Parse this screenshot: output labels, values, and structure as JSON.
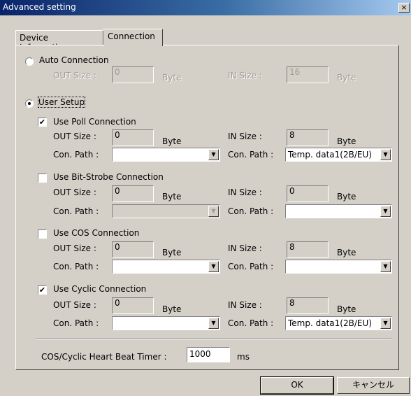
{
  "window": {
    "title": "Advanced setting",
    "close_glyph": "×"
  },
  "tabs": [
    {
      "label": "Device Information",
      "active": false
    },
    {
      "label": "Connection",
      "active": true
    }
  ],
  "auto_connection": {
    "label": "Auto Connection",
    "selected": false,
    "out_size_label": "OUT Size :",
    "out_size_value": "0",
    "out_unit": "Byte",
    "in_size_label": "IN Size :",
    "in_size_value": "16",
    "in_unit": "Byte"
  },
  "user_setup": {
    "label": "User Setup",
    "selected": true
  },
  "sections": [
    {
      "label": "Use Poll Connection",
      "checked": true,
      "out_size_label": "OUT Size :",
      "out_size": "0",
      "out_unit": "Byte",
      "in_size_label": "IN Size :",
      "in_size": "8",
      "in_unit": "Byte",
      "out_path_label": "Con. Path :",
      "out_path": "",
      "in_path_label": "Con. Path :",
      "in_path": "Temp. data1(2B/EU)"
    },
    {
      "label": "Use Bit-Strobe Connection",
      "checked": false,
      "out_size_label": "OUT Size :",
      "out_size": "0",
      "out_unit": "Byte",
      "in_size_label": "IN Size :",
      "in_size": "0",
      "in_unit": "Byte",
      "out_path_label": "Con. Path :",
      "out_path": "",
      "in_path_label": "Con. Path :",
      "in_path": ""
    },
    {
      "label": "Use COS Connection",
      "checked": false,
      "out_size_label": "OUT Size :",
      "out_size": "0",
      "out_unit": "Byte",
      "in_size_label": "IN Size :",
      "in_size": "8",
      "in_unit": "Byte",
      "out_path_label": "Con. Path :",
      "out_path": "",
      "in_path_label": "Con. Path :",
      "in_path": ""
    },
    {
      "label": "Use Cyclic Connection",
      "checked": true,
      "out_size_label": "OUT Size :",
      "out_size": "0",
      "out_unit": "Byte",
      "in_size_label": "IN Size :",
      "in_size": "8",
      "in_unit": "Byte",
      "out_path_label": "Con. Path :",
      "out_path": "",
      "in_path_label": "Con. Path :",
      "in_path": "Temp. data1(2B/EU)"
    }
  ],
  "heartbeat": {
    "label": "COS/Cyclic Heart Beat Timer :",
    "value": "1000",
    "unit": "ms"
  },
  "buttons": {
    "ok": "OK",
    "cancel": "キャンセル"
  },
  "icons": {
    "check": "✔",
    "dropdown_arrow": "▼"
  }
}
